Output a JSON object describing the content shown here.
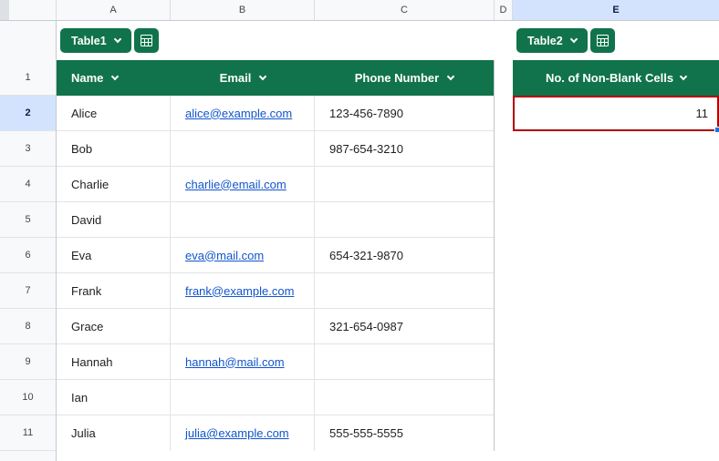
{
  "colors": {
    "table_green": "#11734B",
    "selection_red": "#b10202",
    "active_header_bg": "#d3e3fd",
    "link_blue": "#1155cc",
    "fill_handle_blue": "#1a73e8"
  },
  "icons": {
    "chip_icon": "table-grid-icon",
    "dropdown_icon": "chevron-down-icon"
  },
  "grid": {
    "column_headers": [
      "A",
      "B",
      "C",
      "D",
      "E"
    ],
    "row_numbers": [
      "1",
      "2",
      "3",
      "4",
      "5",
      "6",
      "7",
      "8",
      "9",
      "10",
      "11"
    ]
  },
  "table1": {
    "chip_label": "Table1",
    "columns": [
      "Name",
      "Email",
      "Phone Number"
    ],
    "rows": [
      {
        "name": "Alice",
        "email": "alice@example.com",
        "phone": "123-456-7890"
      },
      {
        "name": "Bob",
        "email": "",
        "phone": "987-654-3210"
      },
      {
        "name": "Charlie",
        "email": "charlie@email.com",
        "phone": ""
      },
      {
        "name": "David",
        "email": "",
        "phone": ""
      },
      {
        "name": "Eva",
        "email": "eva@mail.com",
        "phone": "654-321-9870"
      },
      {
        "name": "Frank",
        "email": "frank@example.com",
        "phone": ""
      },
      {
        "name": "Grace",
        "email": "",
        "phone": "321-654-0987"
      },
      {
        "name": "Hannah",
        "email": "hannah@mail.com",
        "phone": ""
      },
      {
        "name": "Ian",
        "email": "",
        "phone": ""
      },
      {
        "name": "Julia",
        "email": "julia@example.com",
        "phone": "555-555-5555"
      }
    ]
  },
  "table2": {
    "chip_label": "Table2",
    "header": "No. of Non-Blank Cells",
    "value": "11"
  }
}
